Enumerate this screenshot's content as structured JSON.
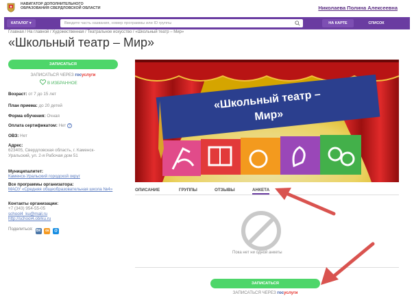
{
  "header": {
    "org_name": "НАВИГАТОР ДОПОЛНИТЕЛЬНОГО ОБРАЗОВАНИЯ СВЕРДЛОВСКОЙ ОБЛАСТИ",
    "user_name": "Николаева Полина Алексеевна"
  },
  "nav": {
    "catalog_label": "КАТАЛОГ",
    "search_placeholder": "Введите часть названия, номер программы или ID группы",
    "map_label": "НА КАРТЕ",
    "list_label": "СПИСОК"
  },
  "breadcrumb": "Главная / На главной / Художественная / Театральное искусство / «Школьный театр – Мир»",
  "page_title": "«Школьный театр – Мир»",
  "sidebar": {
    "enroll_label": "ЗАПИСАТЬСЯ",
    "gosuslugi_prefix": "ЗАПИСАТЬСЯ ЧЕРЕЗ",
    "gosuslugi_brand_a": "гос",
    "gosuslugi_brand_b": "услуги",
    "favorite_label": "В ИЗБРАННОЕ",
    "age_key": "Возраст:",
    "age_value": "от 7 до 15 лет",
    "plan_key": "План приема:",
    "plan_value": "до 20 детей",
    "form_key": "Форма обучения:",
    "form_value": "Очная",
    "cert_key": "Оплата сертификатом:",
    "cert_value": "Нет",
    "ovz_key": "ОВЗ:",
    "ovz_value": "Нет",
    "address_key": "Адрес:",
    "address_value": "623405, Свердловская область, г. Каменск-Уральский, ул. 2-я Рабочая дом 51",
    "municipality_key": "Муниципалитет:",
    "municipality_value": "Каменск-Уральский городской округ",
    "programs_key": "Все программы организатора:",
    "programs_value": "МАОУ «Средняя общеобразовательная школа №4»",
    "contacts_key": "Контакты организации:",
    "phone": "+7 (343) 954-55-05",
    "email": "school4_ku@mail.ru",
    "site": "http://school4.obrku.ru",
    "share_label": "Поделиться:",
    "share_vk": "ВК",
    "share_ok": "ок",
    "share_mm": "@"
  },
  "image": {
    "title_line1": "«Школьный театр –",
    "title_line2": "Мир»"
  },
  "tabs": [
    "ОПИСАНИЕ",
    "ГРУППЫ",
    "ОТЗЫВЫ",
    "АНКЕТА"
  ],
  "empty_text": "Пока нет ни одной анкеты",
  "bottom": {
    "enroll_label": "ЗАПИСАТЬСЯ",
    "gosuslugi_prefix": "ЗАПИСАТЬСЯ ЧЕРЕЗ",
    "gosuslugi_brand_a": "гос",
    "gosuslugi_brand_b": "услуги"
  },
  "colors": {
    "accent": "#6a3ca1",
    "enroll": "#4ed66a",
    "arrow": "#d9534f",
    "curtain": "#c81d1d"
  }
}
